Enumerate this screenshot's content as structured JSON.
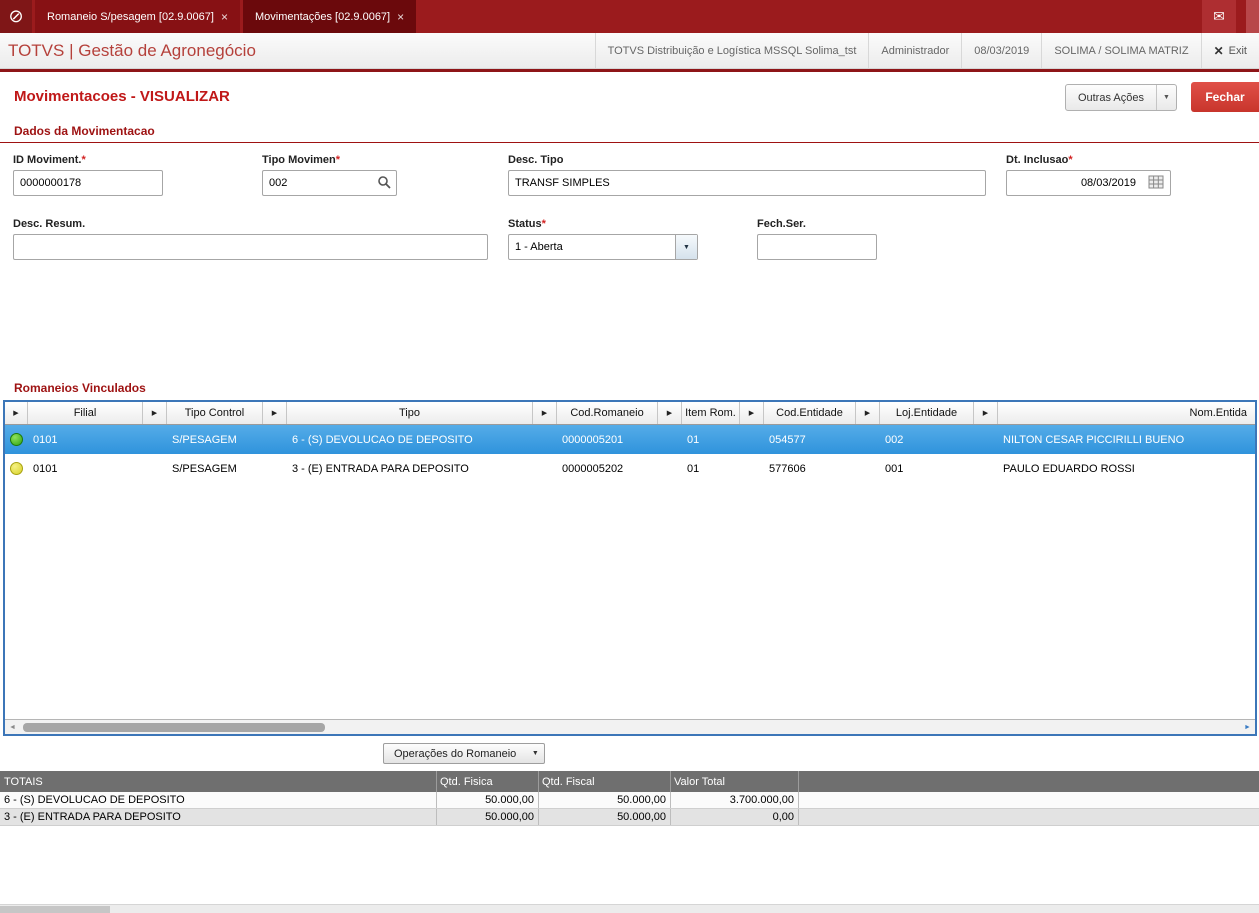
{
  "icons": {
    "block": "⊘",
    "mail": "✉",
    "tab_close": "×",
    "exit_close": "✕",
    "caret_down": "▼",
    "header_arrow": "▶",
    "scroll_left": "◄",
    "scroll_right": "►"
  },
  "topbar": {
    "tabs": [
      {
        "label": "Romaneio S/pesagem [02.9.0067]"
      },
      {
        "label": "Movimentações [02.9.0067]"
      }
    ]
  },
  "header": {
    "brand": "TOTVS | Gestão de Agronegócio",
    "environment": "TOTVS Distribuição e Logística MSSQL Solima_tst",
    "user": "Administrador",
    "date": "08/03/2019",
    "company": "SOLIMA / SOLIMA MATRIZ",
    "exit_label": "Exit"
  },
  "page": {
    "title": "Movimentacoes - VISUALIZAR",
    "outras_acoes_label": "Outras Ações",
    "fechar_label": "Fechar"
  },
  "form": {
    "section_title": "Dados da Movimentacao",
    "fields": {
      "id_moviment": {
        "label": "ID Moviment.",
        "req": "*",
        "value": "0000000178"
      },
      "tipo_movimen": {
        "label": "Tipo Movimen",
        "req": "*",
        "value": "002"
      },
      "desc_tipo": {
        "label": "Desc. Tipo",
        "value": "TRANSF SIMPLES"
      },
      "dt_inclusao": {
        "label": "Dt. Inclusao",
        "req": "*",
        "value": "08/03/2019"
      },
      "desc_resum": {
        "label": "Desc. Resum.",
        "value": ""
      },
      "status": {
        "label": "Status",
        "req": "*",
        "value": "1 - Aberta"
      },
      "fech_ser": {
        "label": "Fech.Ser.",
        "value": ""
      }
    }
  },
  "grid": {
    "section_title": "Romaneios Vinculados",
    "columns": [
      "Filial",
      "Tipo Control",
      "Tipo",
      "Cod.Romaneio",
      "Item Rom.",
      "Cod.Entidade",
      "Loj.Entidade",
      "Nom.Entida"
    ],
    "rows": [
      {
        "filial": "0101",
        "tipo_control": "S/PESAGEM",
        "tipo": "6 - (S) DEVOLUCAO DE DEPOSITO",
        "cod_romaneio": "0000005201",
        "item_rom": "01",
        "cod_entidade": "054577",
        "loj_entidade": "002",
        "nom_entidade": "NILTON CESAR PICCIRILLI BUENO"
      },
      {
        "filial": "0101",
        "tipo_control": "S/PESAGEM",
        "tipo": "3 - (E) ENTRADA PARA DEPOSITO",
        "cod_romaneio": "0000005202",
        "item_rom": "01",
        "cod_entidade": "577606",
        "loj_entidade": "001",
        "nom_entidade": "PAULO EDUARDO ROSSI"
      }
    ],
    "operacoes_label": "Operações do Romaneio"
  },
  "totals": {
    "columns": [
      "TOTAIS",
      "Qtd. Fisica",
      "Qtd. Fiscal",
      "Valor Total"
    ],
    "rows": [
      {
        "label": "6 - (S) DEVOLUCAO DE DEPOSITO",
        "qtd_fisica": "50.000,00",
        "qtd_fiscal": "50.000,00",
        "valor_total": "3.700.000,00"
      },
      {
        "label": "3 - (E) ENTRADA PARA DEPOSITO",
        "qtd_fisica": "50.000,00",
        "qtd_fiscal": "50.000,00",
        "valor_total": "0,00"
      }
    ]
  }
}
